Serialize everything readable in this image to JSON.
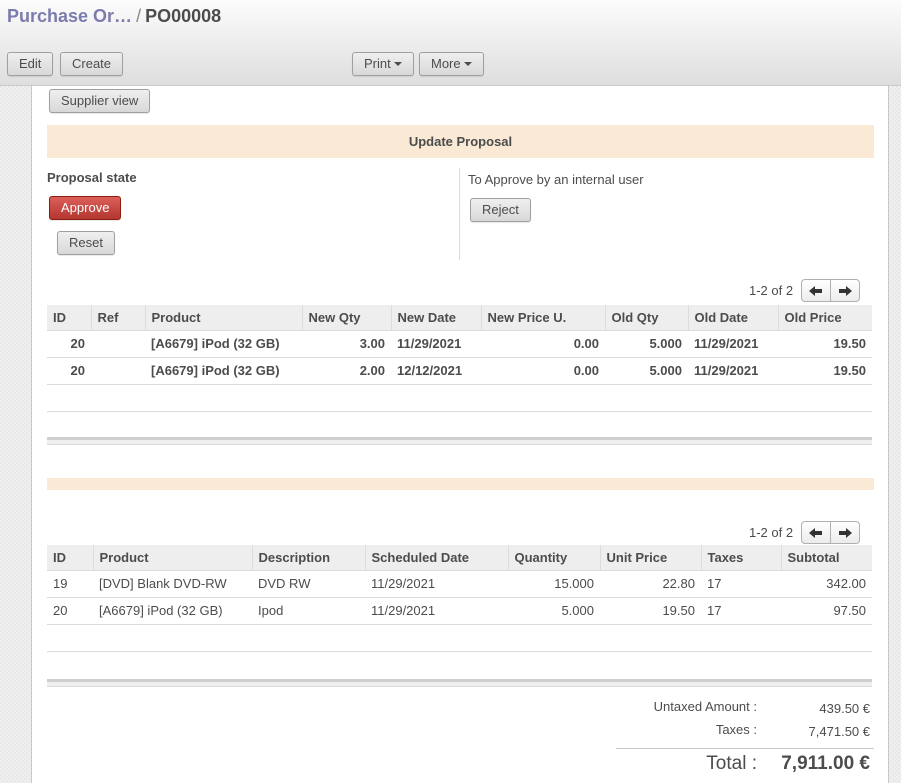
{
  "breadcrumb": {
    "parent": "Purchase Or…",
    "separator": "/",
    "current": "PO00008"
  },
  "toolbar": {
    "edit": "Edit",
    "create": "Create",
    "print": "Print",
    "more": "More"
  },
  "form": {
    "supplier_view": "Supplier view",
    "update_proposal_banner": "Update Proposal",
    "proposal_state_label": "Proposal state",
    "approve": "Approve",
    "reset": "Reset",
    "approve_note": "To Approve by an internal user",
    "reject": "Reject"
  },
  "proposal_table": {
    "pager": "1-2 of 2",
    "columns": [
      "ID",
      "Ref",
      "Product",
      "New Qty",
      "New Date",
      "New Price U.",
      "Old Qty",
      "Old Date",
      "Old Price"
    ],
    "rows": [
      [
        "20",
        "",
        "[A6679] iPod (32 GB)",
        "3.00",
        "11/29/2021",
        "0.00",
        "5.000",
        "11/29/2021",
        "19.50"
      ],
      [
        "20",
        "",
        "[A6679] iPod (32 GB)",
        "2.00",
        "12/12/2021",
        "0.00",
        "5.000",
        "11/29/2021",
        "19.50"
      ]
    ]
  },
  "lines_table": {
    "pager": "1-2 of 2",
    "columns": [
      "ID",
      "Product",
      "Description",
      "Scheduled Date",
      "Quantity",
      "Unit Price",
      "Taxes",
      "Subtotal"
    ],
    "rows": [
      [
        "19",
        "[DVD] Blank DVD-RW",
        "DVD RW",
        "11/29/2021",
        "15.000",
        "22.80",
        "17",
        "342.00"
      ],
      [
        "20",
        "[A6679] iPod (32 GB)",
        "Ipod",
        "11/29/2021",
        "5.000",
        "19.50",
        "17",
        "97.50"
      ]
    ]
  },
  "totals": {
    "untaxed_label": "Untaxed Amount :",
    "untaxed_value": "439.50 €",
    "taxes_label": "Taxes :",
    "taxes_value": "7,471.50 €",
    "total_label": "Total :",
    "total_value": "7,911.00 €"
  },
  "icons": {
    "prev": "arrow-left-icon",
    "next": "arrow-right-icon",
    "dropdown": "caret-down-icon"
  },
  "colors": {
    "breadcrumb_link": "#7c7bad",
    "banner_bg": "#f9e9d5",
    "primary_button": "#c9423b"
  }
}
